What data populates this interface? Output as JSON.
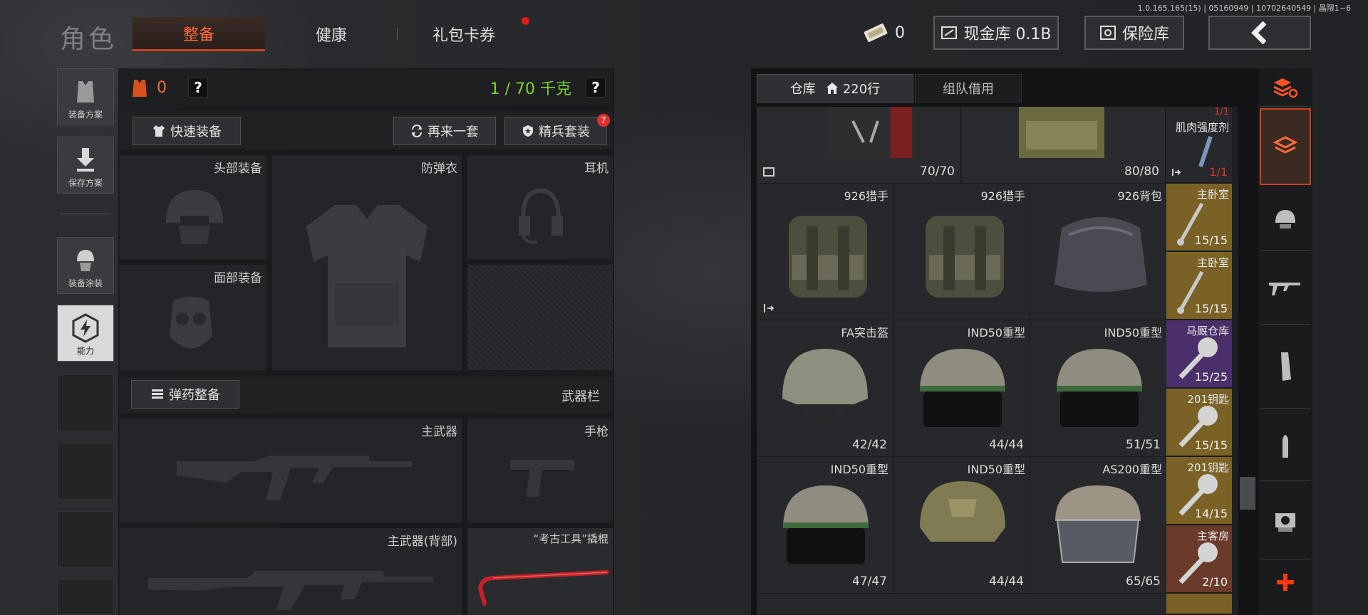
{
  "version_text": "1.0.165.165(15) | 05160949 | 10702640549 | 晶隈1~6",
  "nav": {
    "title": "角色",
    "tabs": [
      {
        "label": "整备"
      },
      {
        "label": "健康"
      },
      {
        "label": "礼包卡券"
      }
    ]
  },
  "top": {
    "ticket_count": "0",
    "cash_label": "现金库 0.1B",
    "safe_label": "保险库"
  },
  "loadout": {
    "armor_value": "0",
    "help": "?",
    "weight": "1 / 70 千克",
    "quick_equip": "快速装备",
    "again": "再来一套",
    "elite": "精兵套装",
    "elite_badge": "7",
    "slots": {
      "head": "头部装备",
      "armor": "防弹衣",
      "headset": "耳机",
      "face": "面部装备",
      "primary": "主武器",
      "pistol": "手枪",
      "primary_back": "主武器(背部)",
      "melee": "“考古工具”撬棍"
    },
    "ammo_button": "弹药整备",
    "weapon_bar": "武器栏"
  },
  "side": [
    {
      "label": "装备方案"
    },
    {
      "label": "保存方案"
    },
    {
      "label": "装备涂装"
    },
    {
      "label": "能力"
    }
  ],
  "storage": {
    "tab": "仓库",
    "rows": "220行",
    "team_tab": "组队借用",
    "row0": [
      {
        "count": "70/70"
      },
      {
        "count": "80/80"
      }
    ],
    "items": [
      {
        "name": "926猎手"
      },
      {
        "name": "926猎手"
      },
      {
        "name": "926背包"
      },
      {
        "name": "FA突击盔",
        "count": "42/42"
      },
      {
        "name": "IND50重型",
        "count": "44/44"
      },
      {
        "name": "IND50重型",
        "count": "51/51"
      },
      {
        "name": "IND50重型",
        "count": "47/47"
      },
      {
        "name": "IND50重型",
        "count": "44/44"
      },
      {
        "name": "AS200重型",
        "count": "65/65"
      }
    ],
    "keys": [
      {
        "name": "肌肉强度剂",
        "count": "1/1"
      },
      {
        "name": "主卧室",
        "count": "15/15"
      },
      {
        "name": "主卧室",
        "count": "15/15"
      },
      {
        "name": "马厩仓库",
        "count": "15/25"
      },
      {
        "name": "201钥匙",
        "count": "15/15"
      },
      {
        "name": "201钥匙",
        "count": "14/15"
      },
      {
        "name": "主客房",
        "count": "2/10"
      }
    ],
    "top_right_count": "1/1"
  },
  "colors": {
    "accent": "#c8421f",
    "green": "#7bd12a",
    "gold": "#8a6a2a",
    "purple": "#4a2f6a",
    "red": "#ff5522"
  }
}
